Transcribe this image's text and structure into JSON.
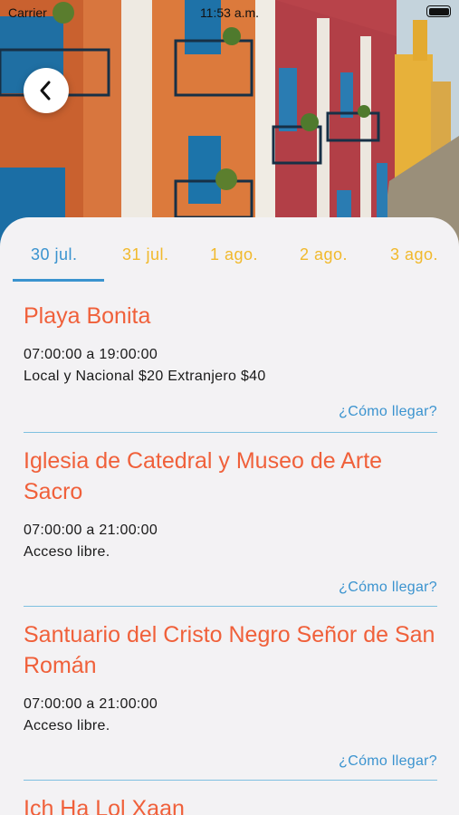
{
  "status_bar": {
    "carrier": "Carrier",
    "time": "11:53 a.m."
  },
  "header": {
    "back_icon": "chevron-left-icon"
  },
  "tabs": [
    {
      "label": "30 jul.",
      "active": true
    },
    {
      "label": "31 jul.",
      "active": false
    },
    {
      "label": "1 ago.",
      "active": false
    },
    {
      "label": "2 ago.",
      "active": false
    },
    {
      "label": "3 ago.",
      "active": false
    }
  ],
  "places": [
    {
      "name": "Playa Bonita",
      "hours": "07:00:00 a 19:00:00",
      "price": "Local y Nacional $20 Extranjero $40",
      "directions": "¿Cómo llegar?"
    },
    {
      "name": "Iglesia de Catedral y Museo de Arte Sacro",
      "hours": "07:00:00 a 21:00:00",
      "price": "Acceso libre.",
      "directions": "¿Cómo llegar?"
    },
    {
      "name": "Santuario del Cristo Negro Señor de San Román",
      "hours": "07:00:00 a 21:00:00",
      "price": "Acceso libre.",
      "directions": "¿Cómo llegar?"
    },
    {
      "name": "Ich Ha Lol Xaan"
    }
  ],
  "colors": {
    "accent_blue": "#3a93cf",
    "tab_inactive": "#f1b92c",
    "title_orange": "#f0603a",
    "divider": "#7ec0e0"
  }
}
